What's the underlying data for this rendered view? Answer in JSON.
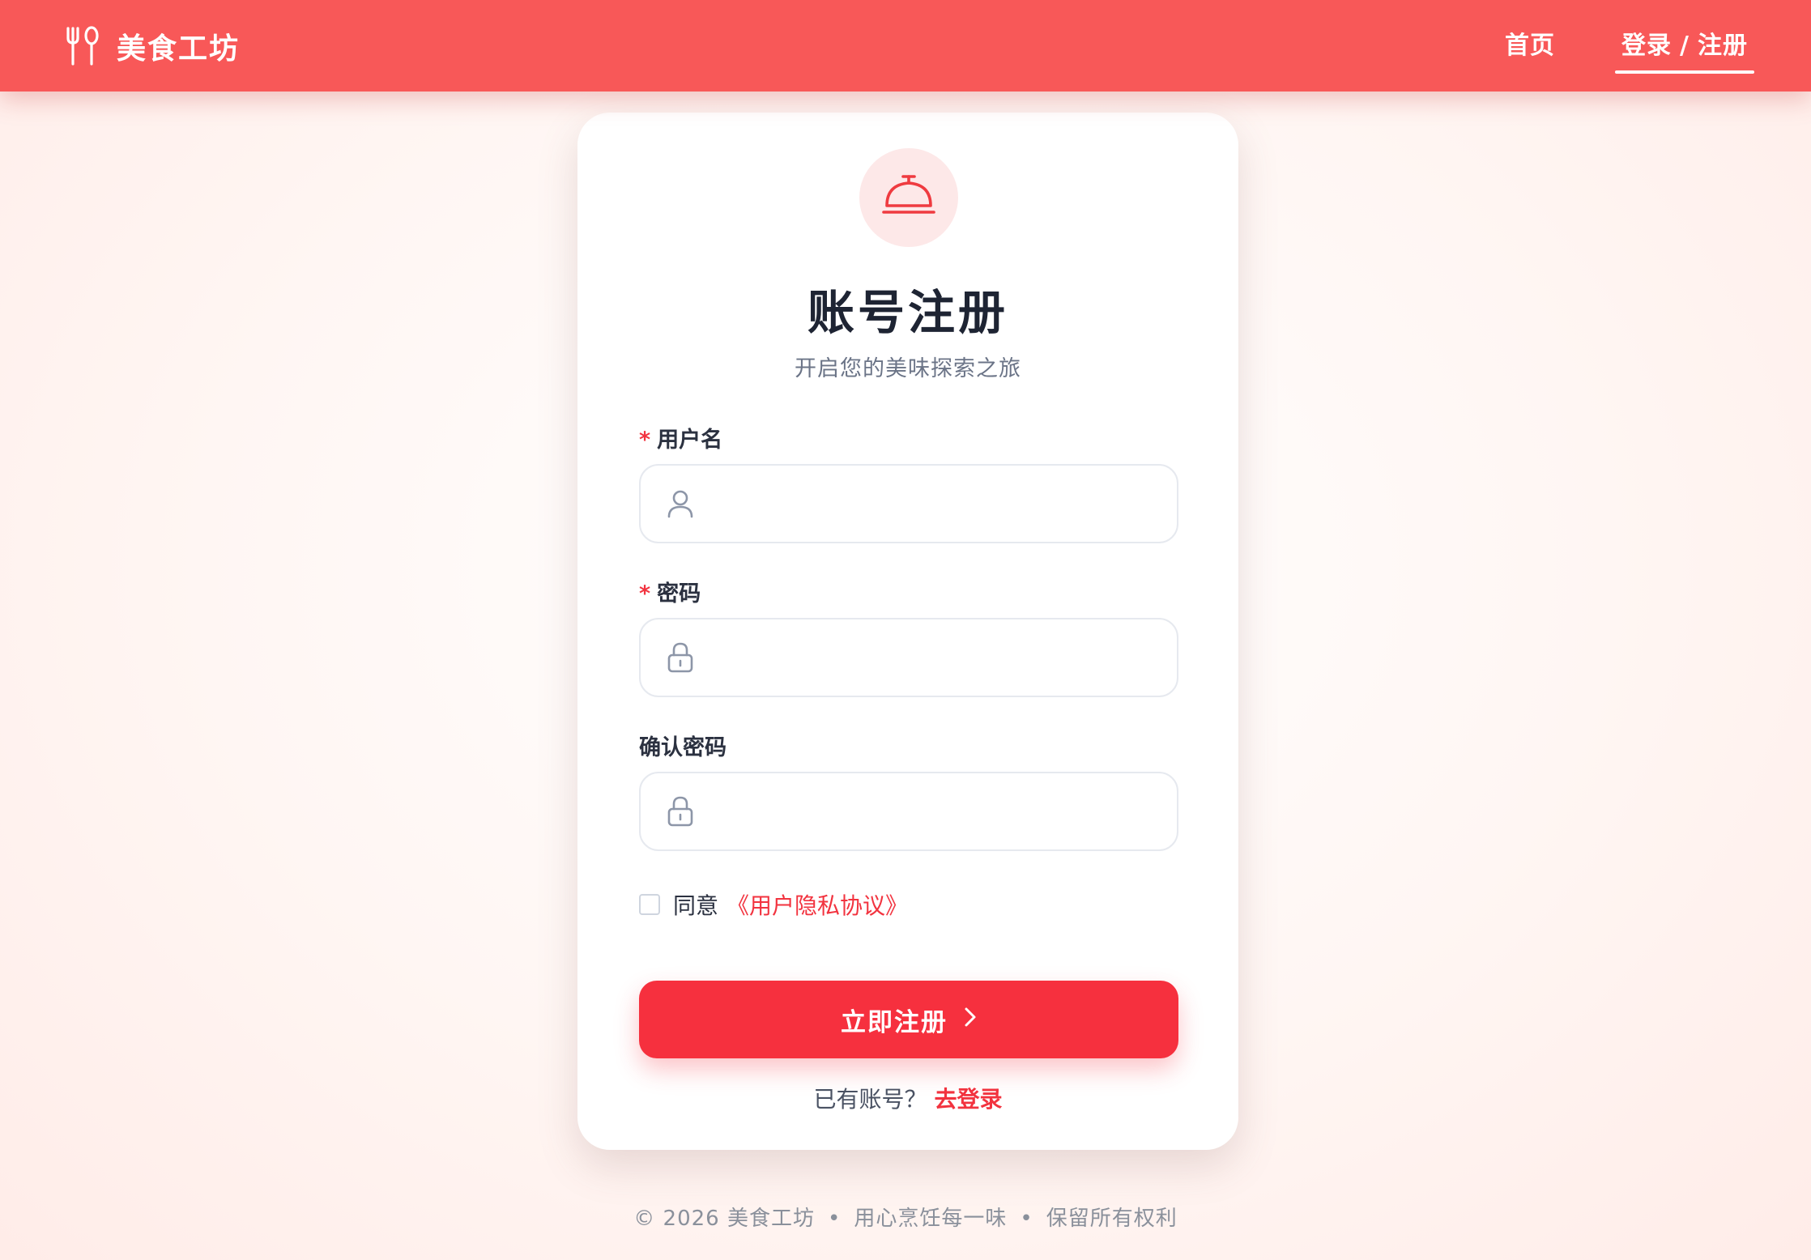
{
  "header": {
    "brand_name": "美食工坊",
    "nav": {
      "home": "首页",
      "login": "登录",
      "separator": "/",
      "register": "注册"
    }
  },
  "form": {
    "title": "账号注册",
    "subtitle": "开启您的美味探索之旅",
    "required_mark": "*",
    "username": {
      "label": "用户名",
      "value": "",
      "placeholder": ""
    },
    "password": {
      "label": "密码",
      "value": "",
      "placeholder": ""
    },
    "confirm_password": {
      "label": "确认密码",
      "value": "",
      "placeholder": ""
    },
    "agree": {
      "text": "同意",
      "link": "《用户隐私协议》",
      "checked": false
    },
    "submit_label": "立即注册",
    "login_prompt": "已有账号？",
    "login_link": "去登录"
  },
  "footer": {
    "copyright": "© 2026 美食工坊",
    "slogan": "用心烹饪每一味",
    "rights": "保留所有权利",
    "separator": "•"
  },
  "icons": {
    "brand": "fork-spoon-icon",
    "logo": "service-bell-icon",
    "username": "user-icon",
    "password": "lock-icon",
    "confirm_password": "lock-icon",
    "submit": "chevron-right-icon"
  },
  "colors": {
    "header": "#f85858",
    "accent": "#f6303e",
    "logo_bg": "#fde8e8"
  }
}
